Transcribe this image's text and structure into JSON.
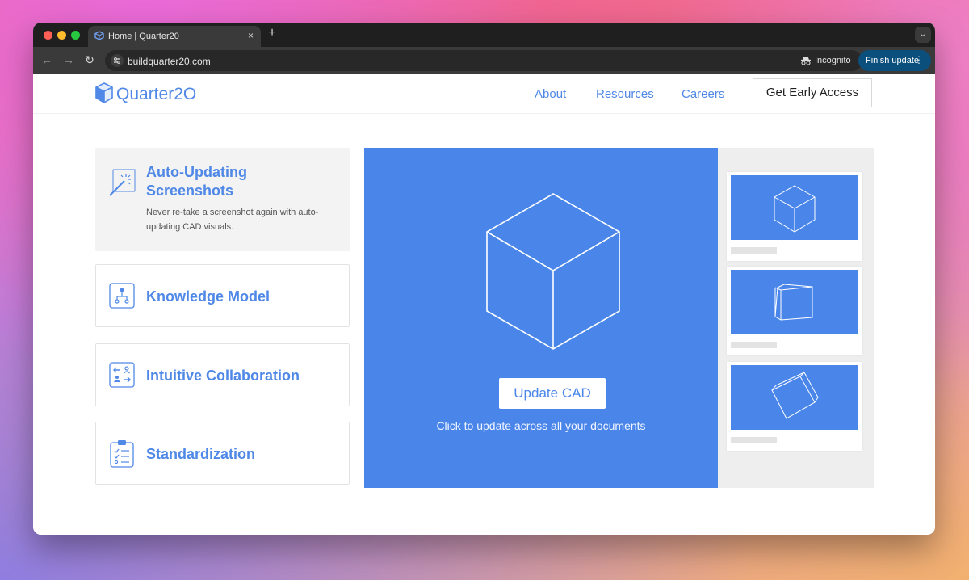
{
  "browser": {
    "tab_title": "Home | Quarter20",
    "tab_close": "×",
    "new_tab": "+",
    "tab_menu": "⌄",
    "url": "buildquarter20.com",
    "back": "←",
    "forward": "→",
    "reload": "↻",
    "incognito_label": "Incognito",
    "finish_update_label": "Finish update",
    "menu_dots": "⋮"
  },
  "site": {
    "logo_text": "Quarter2O",
    "nav": [
      "About",
      "Resources",
      "Careers"
    ],
    "cta_label": "Get Early Access"
  },
  "features": [
    {
      "title": "Auto-Updating Screenshots",
      "description": "Never re-take a screenshot again with auto-updating CAD visuals.",
      "icon": "magic-wand-icon",
      "active": true
    },
    {
      "title": "Knowledge Model",
      "icon": "hierarchy-icon",
      "active": false
    },
    {
      "title": "Intuitive Collaboration",
      "icon": "exchange-users-icon",
      "active": false
    },
    {
      "title": "Standardization",
      "icon": "clipboard-checklist-icon",
      "active": false
    }
  ],
  "hero": {
    "button_label": "Update CAD",
    "subtitle": "Click to update across all your documents"
  },
  "colors": {
    "brand_blue": "#4a86ea",
    "link_blue": "#4f88e6",
    "finish_update_bg": "#0b4f7c"
  }
}
